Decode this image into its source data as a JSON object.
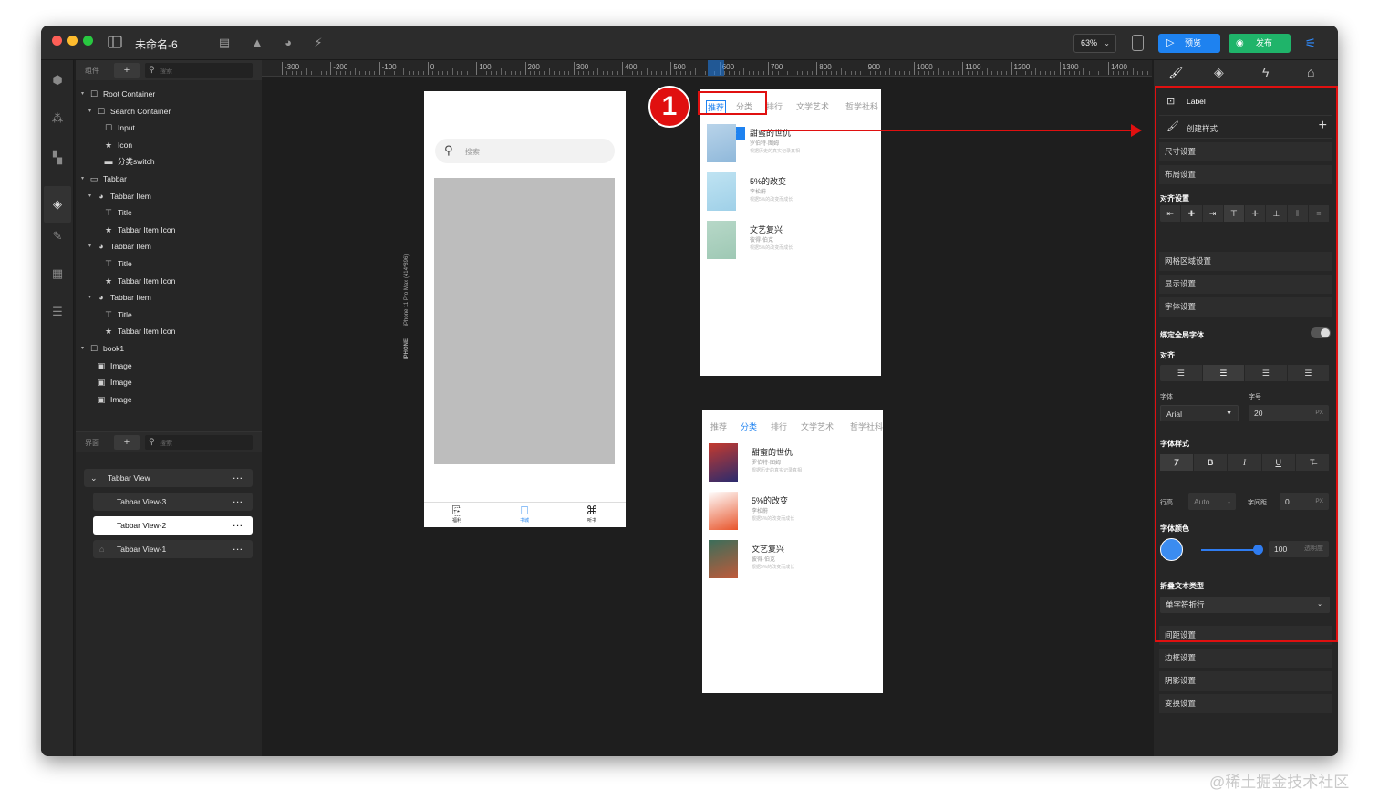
{
  "window": {
    "title": "未命名-6",
    "zoom": "63%",
    "preview_label": "预览",
    "publish_label": "发布"
  },
  "colors": {
    "accent": "#1e82f0",
    "publish": "#1fb46a",
    "highlight": "#e01010"
  },
  "components_panel": {
    "header_label": "组件",
    "search_placeholder": "搜索",
    "tree": [
      {
        "label": "Root Container",
        "icon": "square-icon",
        "indent": 0
      },
      {
        "label": "Search Container",
        "icon": "square-icon",
        "indent": 1
      },
      {
        "label": "Input",
        "icon": "square-icon",
        "indent": 2
      },
      {
        "label": "Icon",
        "icon": "star-icon",
        "indent": 2
      },
      {
        "label": "分类switch",
        "icon": "switch-icon",
        "indent": 2
      },
      {
        "label": "Tabbar",
        "icon": "tabbar-icon",
        "indent": 0
      },
      {
        "label": "Tabbar Item",
        "icon": "pie-icon",
        "indent": 1
      },
      {
        "label": "Title",
        "icon": "text-icon",
        "indent": 2
      },
      {
        "label": "Tabbar Item Icon",
        "icon": "star-icon",
        "indent": 2
      },
      {
        "label": "Tabbar Item",
        "icon": "pie-icon",
        "indent": 1
      },
      {
        "label": "Title",
        "icon": "text-icon",
        "indent": 2
      },
      {
        "label": "Tabbar Item Icon",
        "icon": "star-icon",
        "indent": 2
      },
      {
        "label": "Tabbar Item",
        "icon": "pie-icon",
        "indent": 1
      },
      {
        "label": "Title",
        "icon": "text-icon",
        "indent": 2
      },
      {
        "label": "Tabbar Item Icon",
        "icon": "star-icon",
        "indent": 2
      },
      {
        "label": "book1",
        "icon": "square-icon",
        "indent": 0
      },
      {
        "label": "Image",
        "icon": "image-icon",
        "indent": 1
      },
      {
        "label": "Image",
        "icon": "image-icon",
        "indent": 1
      },
      {
        "label": "Image",
        "icon": "image-icon",
        "indent": 1
      }
    ]
  },
  "pages_panel": {
    "header_label": "界面",
    "search_placeholder": "搜索",
    "group": "Tabbar View",
    "pages": [
      "Tabbar View-3",
      "Tabbar View-2",
      "Tabbar View-1"
    ]
  },
  "ruler": {
    "labels": [
      "-300",
      "-200",
      "-100",
      "0",
      "100",
      "200",
      "300",
      "400",
      "500",
      "600",
      "700",
      "800",
      "900",
      "1000",
      "1100",
      "1200",
      "1300",
      "1400"
    ]
  },
  "canvas": {
    "device_label": "IPHONE",
    "device_detail": "iPhone 11 Pro Max (414*896)",
    "search_placeholder": "搜索",
    "tab_labels": [
      "福利",
      "书城",
      "听书"
    ],
    "annotation_number": "1",
    "size_badge": "42 x 22",
    "categories": [
      "推荐",
      "分类",
      "排行",
      "文学艺术",
      "哲学社科"
    ],
    "books": [
      {
        "title": "甜蜜的世仇",
        "author": "罗伯特·图姆",
        "desc": "根据历史的真实记录真相"
      },
      {
        "title": "5%的改变",
        "author": "李松蔚",
        "desc": "根据5%的改变而成长"
      },
      {
        "title": "文艺复兴",
        "author": "彼得·伯克",
        "desc": "根据5%的改变而成长"
      }
    ]
  },
  "inspector": {
    "tabs": [
      "brush-icon",
      "diamond-icon",
      "bolt-icon",
      "building-icon"
    ],
    "element_label": "Label",
    "create_style": "创建样式",
    "sections_top": [
      "尺寸设置",
      "布局设置"
    ],
    "align_title": "对齐设置",
    "sections_mid": [
      "网格区域设置",
      "显示设置",
      "字体设置"
    ],
    "bind_global_font": "绑定全局字体",
    "align_label": "对齐",
    "font_label": "字体",
    "font_value": "Arial",
    "size_label": "字号",
    "size_value": "20",
    "size_unit": "PX",
    "font_style_label": "字体样式",
    "font_styles": [
      "Ⱦ",
      "B",
      "I",
      "U",
      "T̶"
    ],
    "line_height_label": "行高",
    "line_height_value": "Auto",
    "line_height_unit": "-",
    "letter_spacing_label": "字间距",
    "letter_spacing_value": "0",
    "letter_spacing_unit": "PX",
    "font_color_label": "字体颜色",
    "font_color": "#3b8cf0",
    "opacity_value": "100",
    "opacity_label": "透明度",
    "wrap_label": "折叠文本类型",
    "wrap_value": "单字符折行",
    "sections_bottom": [
      "间距设置",
      "边框设置",
      "阴影设置",
      "变换设置"
    ]
  },
  "watermark": "@稀土掘金技术社区"
}
